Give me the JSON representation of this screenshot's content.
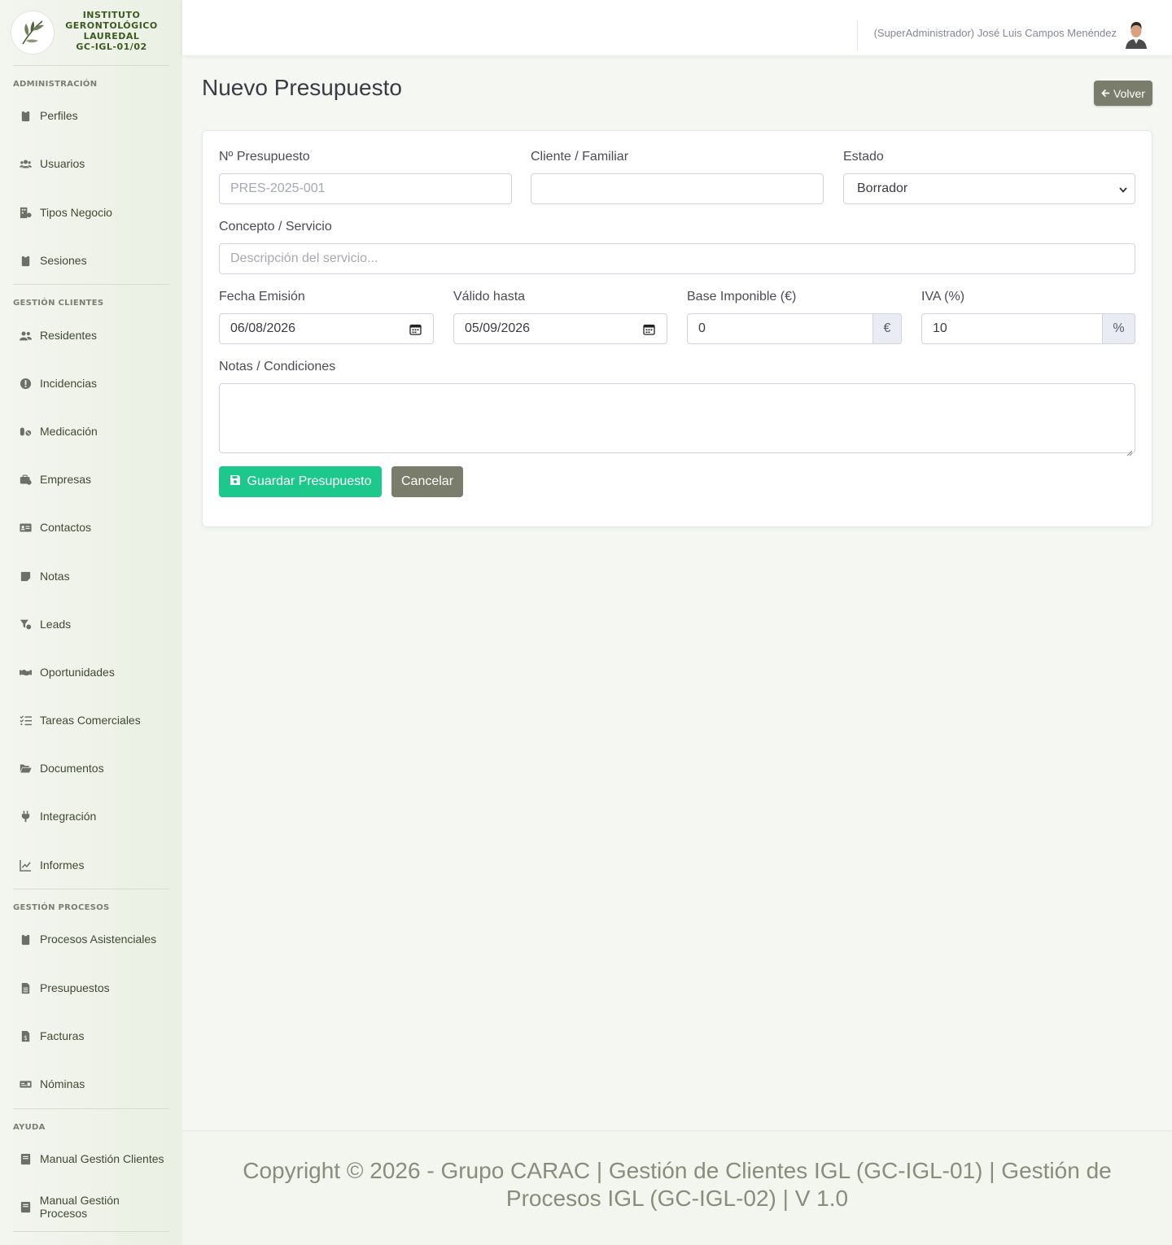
{
  "brand": {
    "line1": "INSTITUTO",
    "line2": "GERONTOLÓGICO",
    "line3": "LAUREDAL",
    "line4": "GC-IGL-01/02"
  },
  "sidebar": {
    "sections": {
      "admin": "ADMINISTRACIÓN",
      "clients": "GESTIÓN CLIENTES",
      "processes": "GESTIÓN PROCESOS",
      "help": "AYUDA"
    },
    "items": {
      "perfiles": "Perfiles",
      "usuarios": "Usuarios",
      "tipos_negocio": "Tipos Negocio",
      "sesiones": "Sesiones",
      "residentes": "Residentes",
      "incidencias": "Incidencias",
      "medicacion": "Medicación",
      "empresas": "Empresas",
      "contactos": "Contactos",
      "notas": "Notas",
      "leads": "Leads",
      "oportunidades": "Oportunidades",
      "tareas_comerciales": "Tareas Comerciales",
      "documentos": "Documentos",
      "integracion": "Integración",
      "informes": "Informes",
      "procesos_asistenciales": "Procesos Asistenciales",
      "presupuestos": "Presupuestos",
      "facturas": "Facturas",
      "nominas": "Nóminas",
      "manual_clientes": "Manual Gestión Clientes",
      "manual_procesos": "Manual Gestión Procesos"
    }
  },
  "topbar": {
    "user": "(SuperAdministrador) José Luis Campos Menéndez"
  },
  "page": {
    "title": "Nuevo Presupuesto",
    "back_label": "Volver"
  },
  "form": {
    "numero_label": "Nº Presupuesto",
    "numero_placeholder": "PRES-2025-001",
    "numero_value": "",
    "cliente_label": "Cliente / Familiar",
    "cliente_value": "",
    "estado_label": "Estado",
    "estado_value": "Borrador",
    "concepto_label": "Concepto / Servicio",
    "concepto_placeholder": "Descripción del servicio...",
    "concepto_value": "",
    "fecha_emision_label": "Fecha Emisión",
    "fecha_emision_value": "06/08/2026",
    "valido_hasta_label": "Válido hasta",
    "valido_hasta_value": "05/09/2026",
    "base_label": "Base Imponible (€)",
    "base_value": "0",
    "base_addon": "€",
    "iva_label": "IVA (%)",
    "iva_value": "10",
    "iva_addon": "%",
    "notas_label": "Notas / Condiciones",
    "notas_value": "",
    "save_label": "Guardar Presupuesto",
    "cancel_label": "Cancelar"
  },
  "footer": {
    "line1": "Copyright © 2026 - Grupo CARAC | Gestión de Clientes IGL (GC-IGL-01) | Gestión de",
    "line2": "Procesos IGL (GC-IGL-02) | V 1.0"
  },
  "colors": {
    "accent_green": "#1cc88a",
    "button_olive": "#7a7d6b",
    "brand_text": "#3c5a20"
  },
  "icons": {
    "brand": "olive-branch-logo",
    "back": "arrow-left-icon",
    "save": "floppy-disk-icon",
    "calendar": "calendar-icon",
    "select": "chevron-down-icon"
  }
}
